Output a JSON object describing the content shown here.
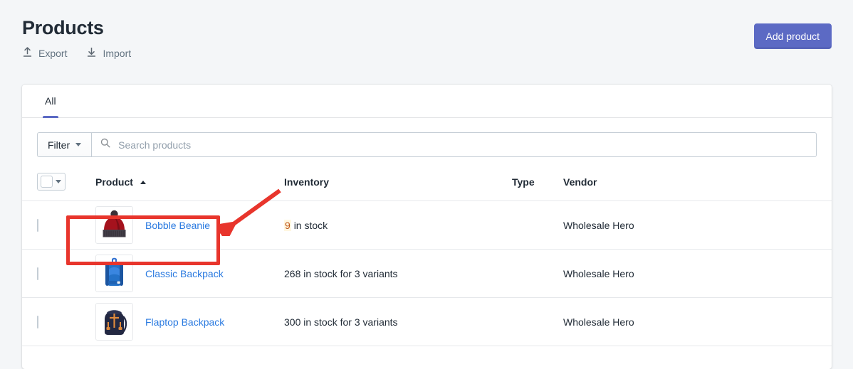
{
  "page": {
    "title": "Products",
    "actions": [
      {
        "label": "Export",
        "icon": "upload-icon"
      },
      {
        "label": "Import",
        "icon": "download-icon"
      }
    ],
    "primary_button": "Add product",
    "accent_color": "#5c6ac4",
    "background_color": "#f4f6f8"
  },
  "tabs": [
    {
      "label": "All",
      "active": true
    }
  ],
  "toolbar": {
    "filter_label": "Filter",
    "search_placeholder": "Search products",
    "search_value": "",
    "search_icon": "search-icon"
  },
  "table": {
    "columns": [
      {
        "key": "select",
        "label": ""
      },
      {
        "key": "product",
        "label": "Product",
        "sort": "asc"
      },
      {
        "key": "inventory",
        "label": "Inventory"
      },
      {
        "key": "type",
        "label": "Type"
      },
      {
        "key": "vendor",
        "label": "Vendor"
      }
    ],
    "rows": [
      {
        "name": "Bobble Beanie",
        "thumb": "beanie-thumbnail",
        "inventory_count": "9",
        "inventory_text": "in stock",
        "inventory_low": true,
        "type": "",
        "vendor": "Wholesale Hero"
      },
      {
        "name": "Classic Backpack",
        "thumb": "blue-backpack-thumbnail",
        "inventory_count": "268",
        "inventory_text": "in stock for 3 variants",
        "inventory_low": false,
        "type": "",
        "vendor": "Wholesale Hero"
      },
      {
        "name": "Flaptop Backpack",
        "thumb": "navy-backpack-thumbnail",
        "inventory_count": "300",
        "inventory_text": "in stock for 3 variants",
        "inventory_low": false,
        "type": "",
        "vendor": "Wholesale Hero"
      }
    ]
  },
  "annotations": {
    "highlight_color": "#e8352c",
    "highlight_target": "Bobble Beanie",
    "arrow": "points-to-highlighted-product-row"
  }
}
